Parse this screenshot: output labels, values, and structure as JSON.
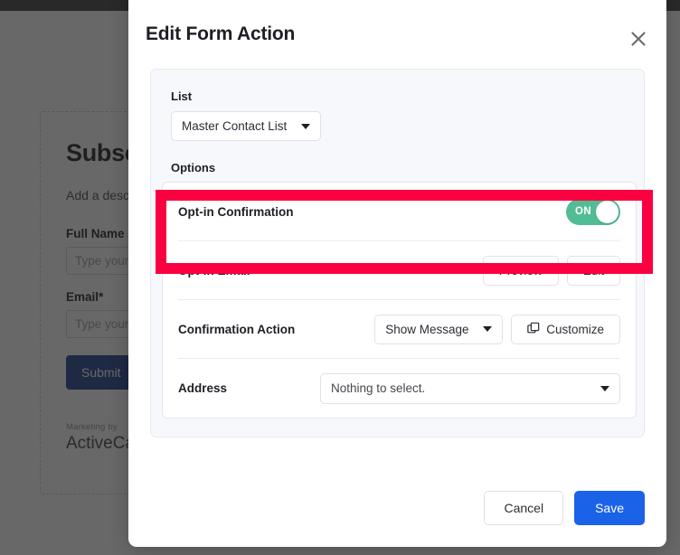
{
  "background_form": {
    "title": "Subscribe",
    "description": "Add a description here.",
    "fields": [
      {
        "label": "Full Name",
        "placeholder": "Type your name"
      },
      {
        "label": "Email*",
        "placeholder": "Type your email"
      }
    ],
    "submit_label": "Submit",
    "credit_prefix": "Marketing by",
    "credit_brand": "ActiveCampaign"
  },
  "modal": {
    "title": "Edit Form Action",
    "close_icon": "close-icon",
    "list": {
      "label": "List",
      "selected": "Master Contact List"
    },
    "options": {
      "label": "Options",
      "rows": [
        {
          "label": "Opt-in Confirmation",
          "control": "toggle",
          "toggle_state": "ON"
        },
        {
          "label": "Opt-in Email",
          "control": "buttons",
          "buttons": [
            "Preview",
            "Edit"
          ]
        },
        {
          "label": "Confirmation Action",
          "control": "select-and-button",
          "selected": "Show Message",
          "button_label": "Customize",
          "button_icon": "duplicate-icon"
        },
        {
          "label": "Address",
          "control": "select",
          "selected": "Nothing to select."
        }
      ]
    },
    "footer": {
      "cancel_label": "Cancel",
      "save_label": "Save"
    }
  },
  "colors": {
    "toggle_on": "#52bd95",
    "save_button": "#1a62e8",
    "highlight": "#fa0040",
    "submit_button": "#1b3b8f"
  }
}
